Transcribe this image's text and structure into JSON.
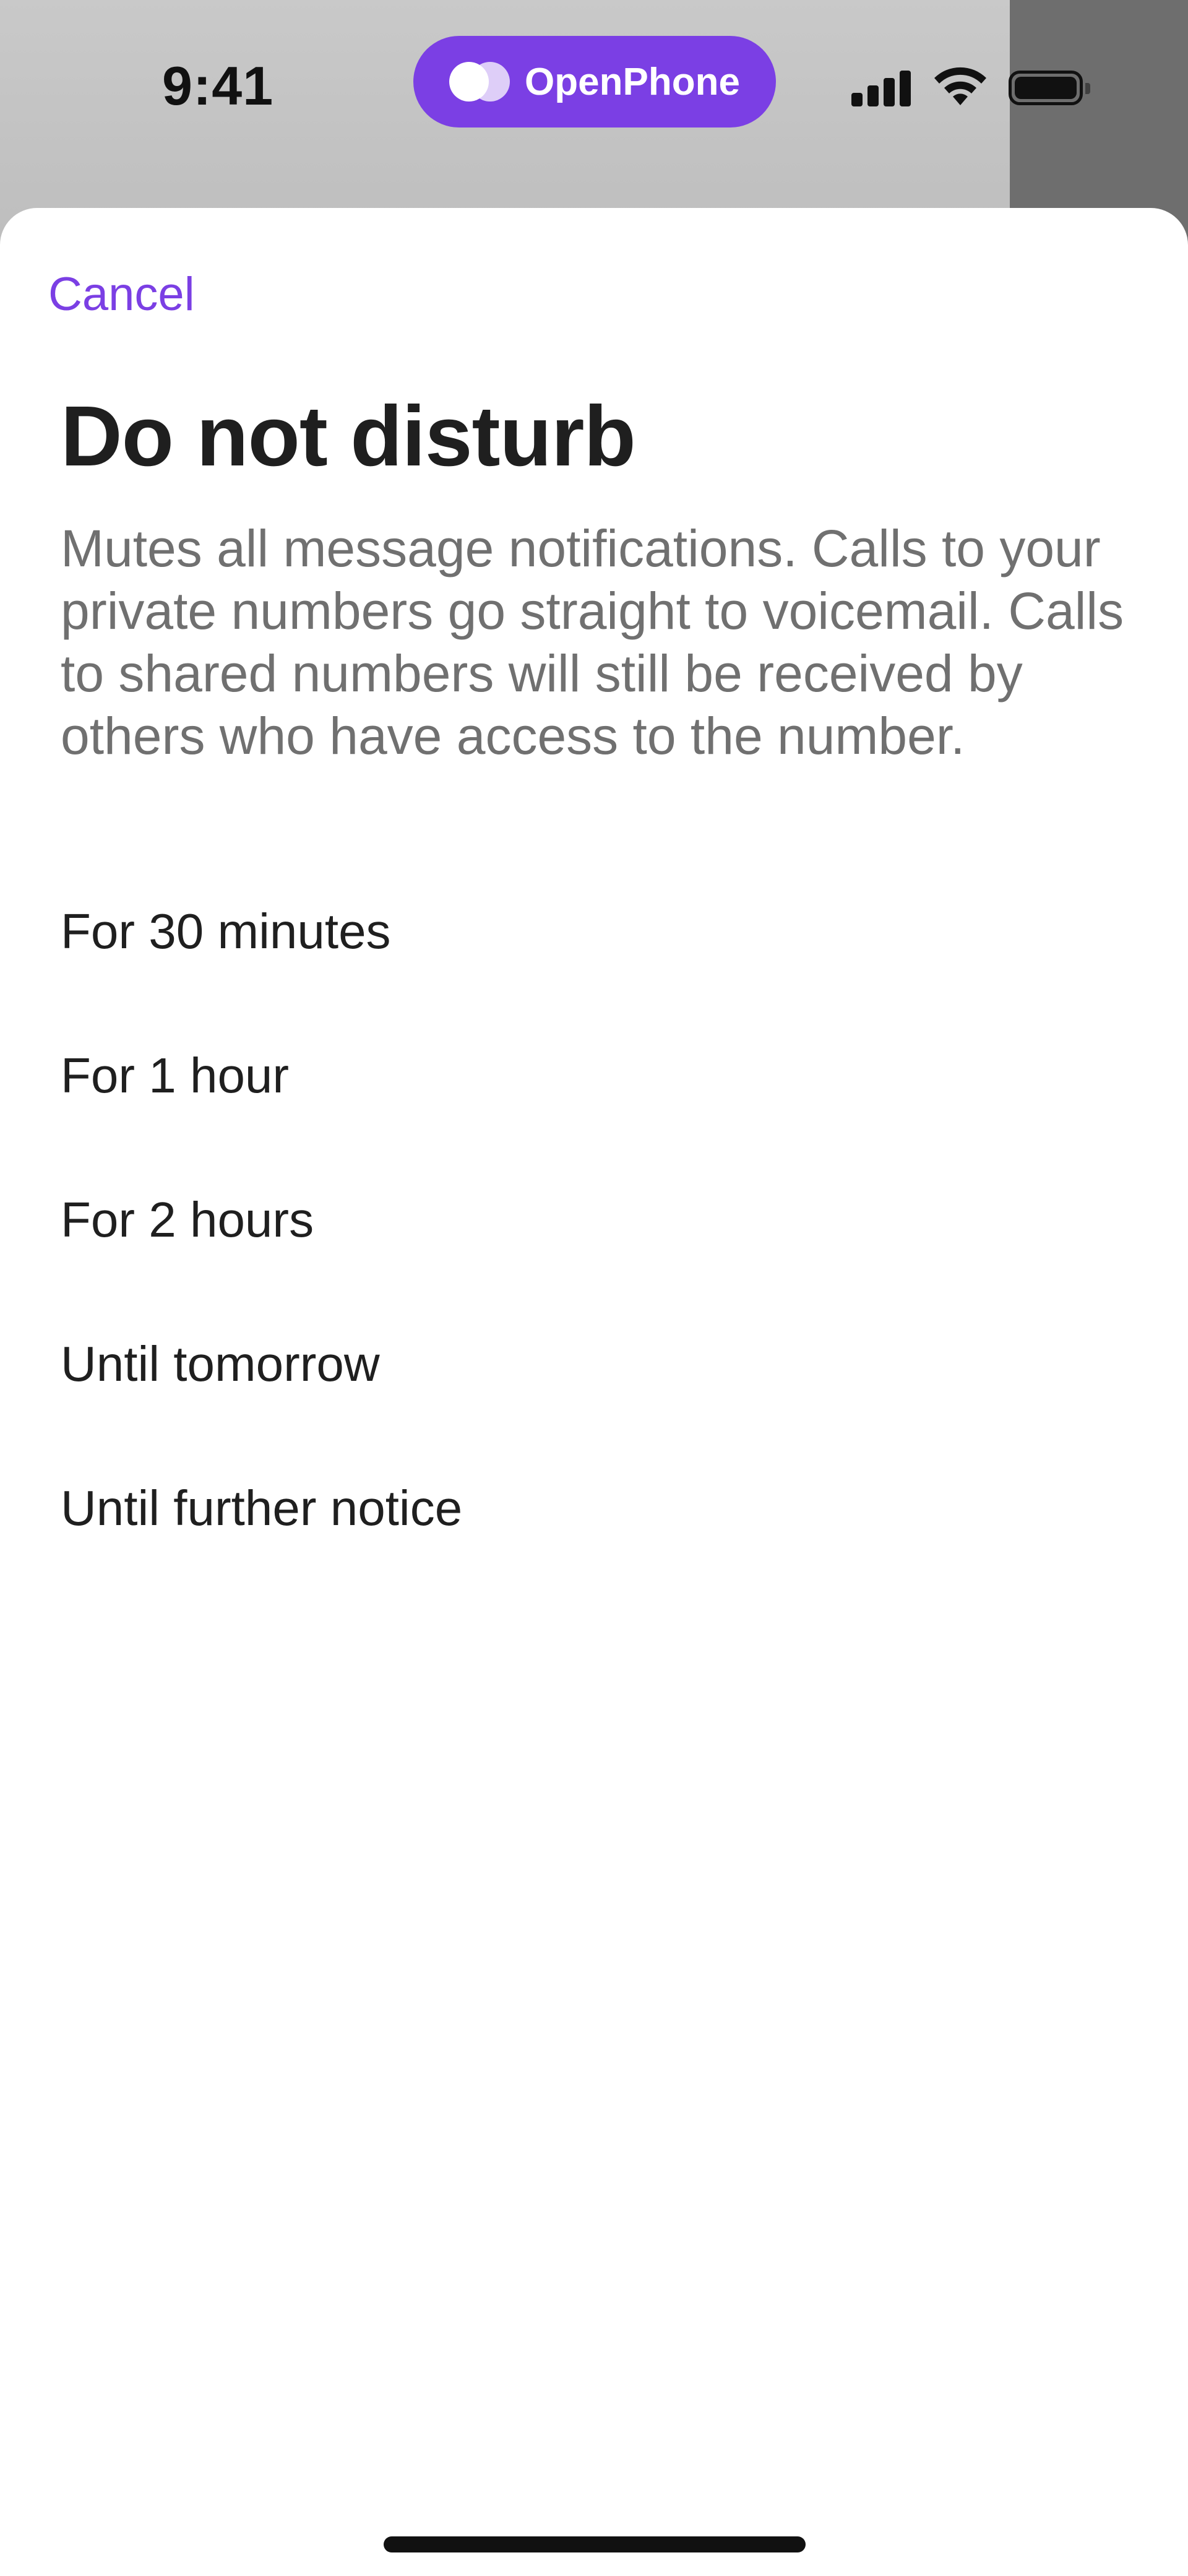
{
  "status_bar": {
    "time": "9:41",
    "brand": "OpenPhone",
    "icons": [
      "cellular-signal-icon",
      "wifi-icon",
      "battery-icon"
    ]
  },
  "sheet": {
    "cancel_label": "Cancel",
    "title": "Do not disturb",
    "description": "Mutes all message notifications. Calls to your private numbers go straight to voicemail. Calls to shared numbers will still be received by others who have access to the number.",
    "options": [
      {
        "label": "For 30 minutes"
      },
      {
        "label": "For 1 hour"
      },
      {
        "label": "For 2 hours"
      },
      {
        "label": "Until tomorrow"
      },
      {
        "label": "Until further notice"
      }
    ]
  },
  "colors": {
    "accent": "#7b3fe4",
    "title": "#1f1f1f",
    "description": "#707070"
  }
}
